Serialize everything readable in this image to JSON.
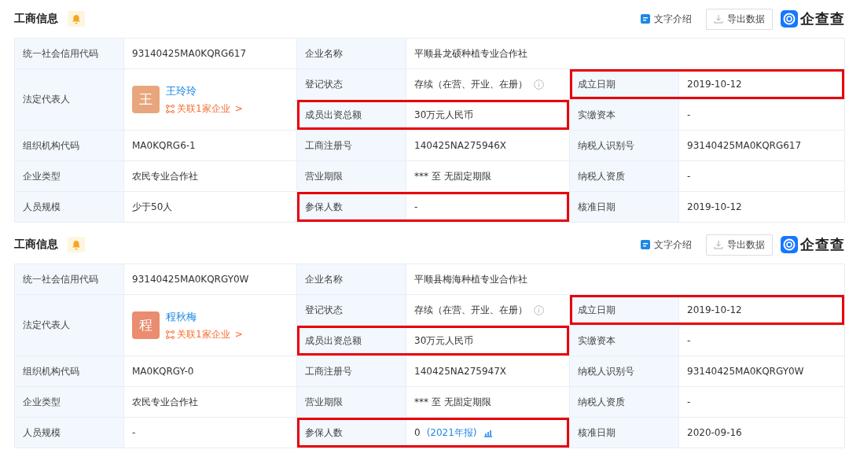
{
  "panels": [
    {
      "title": "工商信息",
      "actions": [
        {
          "label": "文字介绍",
          "kind": "text"
        },
        {
          "label": "导出数据",
          "kind": "outlined"
        }
      ],
      "logo": "企查查",
      "fields": [
        {
          "kind": "normal",
          "label": "统一社会信用代码",
          "value": "93140425MA0KQRG617",
          "highlighted": false
        },
        {
          "kind": "wide",
          "label": "企业名称",
          "value": "平顺县龙硕种植专业合作社",
          "highlighted": false
        },
        {
          "kind": "status",
          "label": "登记状态",
          "value": "存续（在营、开业、在册）",
          "highlighted": false
        },
        {
          "kind": "normal",
          "label": "成立日期",
          "value": "2019-10-12",
          "highlighted": true
        },
        {
          "kind": "person",
          "label": "法定代表人",
          "avatar": "王",
          "color": "#e9a67d",
          "name": "王玲玲",
          "link": "关联1家企业",
          "chevron": ">",
          "highlighted": false
        },
        {
          "kind": "normal",
          "label": "成员出资总额",
          "value": "30万元人民币",
          "highlighted": true
        },
        {
          "kind": "normal",
          "label": "实缴资本",
          "value": "-",
          "highlighted": false
        },
        {
          "kind": "normal",
          "label": "组织机构代码",
          "value": "MA0KQRG6-1",
          "highlighted": false
        },
        {
          "kind": "normal",
          "label": "工商注册号",
          "value": "140425NA275946X",
          "highlighted": false
        },
        {
          "kind": "normal",
          "label": "纳税人识别号",
          "value": "93140425MA0KQRG617",
          "highlighted": false
        },
        {
          "kind": "normal",
          "label": "企业类型",
          "value": "农民专业合作社",
          "highlighted": false
        },
        {
          "kind": "normal",
          "label": "营业期限",
          "value": "*** 至 无固定期限",
          "highlighted": false
        },
        {
          "kind": "normal",
          "label": "纳税人资质",
          "value": "-",
          "highlighted": false
        },
        {
          "kind": "normal",
          "label": "人员规模",
          "value": "少于50人",
          "highlighted": false
        },
        {
          "kind": "normal",
          "label": "参保人数",
          "value": "-",
          "highlighted": true
        },
        {
          "kind": "normal",
          "label": "核准日期",
          "value": "2019-10-12",
          "highlighted": false
        }
      ]
    },
    {
      "title": "工商信息",
      "actions": [
        {
          "label": "文字介绍",
          "kind": "text"
        },
        {
          "label": "导出数据",
          "kind": "outlined"
        }
      ],
      "logo": "企查查",
      "fields": [
        {
          "kind": "normal",
          "label": "统一社会信用代码",
          "value": "93140425MA0KQRGY0W",
          "highlighted": false
        },
        {
          "kind": "wide",
          "label": "企业名称",
          "value": "平顺县梅海种植专业合作社",
          "highlighted": false
        },
        {
          "kind": "status",
          "label": "登记状态",
          "value": "存续（在营、开业、在册）",
          "highlighted": false
        },
        {
          "kind": "normal",
          "label": "成立日期",
          "value": "2019-10-12",
          "highlighted": true
        },
        {
          "kind": "person",
          "label": "法定代表人",
          "avatar": "程",
          "color": "#e98c6f",
          "name": "程秋梅",
          "link": "关联1家企业",
          "chevron": ">",
          "highlighted": false
        },
        {
          "kind": "normal",
          "label": "成员出资总额",
          "value": "30万元人民币",
          "highlighted": true
        },
        {
          "kind": "normal",
          "label": "实缴资本",
          "value": "-",
          "highlighted": false
        },
        {
          "kind": "normal",
          "label": "组织机构代码",
          "value": "MA0KQRGY-0",
          "highlighted": false
        },
        {
          "kind": "normal",
          "label": "工商注册号",
          "value": "140425NA275947X",
          "highlighted": false
        },
        {
          "kind": "normal",
          "label": "纳税人识别号",
          "value": "93140425MA0KQRGY0W",
          "highlighted": false
        },
        {
          "kind": "normal",
          "label": "企业类型",
          "value": "农民专业合作社",
          "highlighted": false
        },
        {
          "kind": "normal",
          "label": "营业期限",
          "value": "*** 至 无固定期限",
          "highlighted": false
        },
        {
          "kind": "normal",
          "label": "纳税人资质",
          "value": "-",
          "highlighted": false
        },
        {
          "kind": "normal",
          "label": "人员规模",
          "value": "-",
          "highlighted": false
        },
        {
          "kind": "report",
          "label": "参保人数",
          "value": "0",
          "link": "(2021年报)",
          "highlighted": true
        },
        {
          "kind": "normal",
          "label": "核准日期",
          "value": "2020-09-16",
          "highlighted": false
        }
      ]
    }
  ]
}
